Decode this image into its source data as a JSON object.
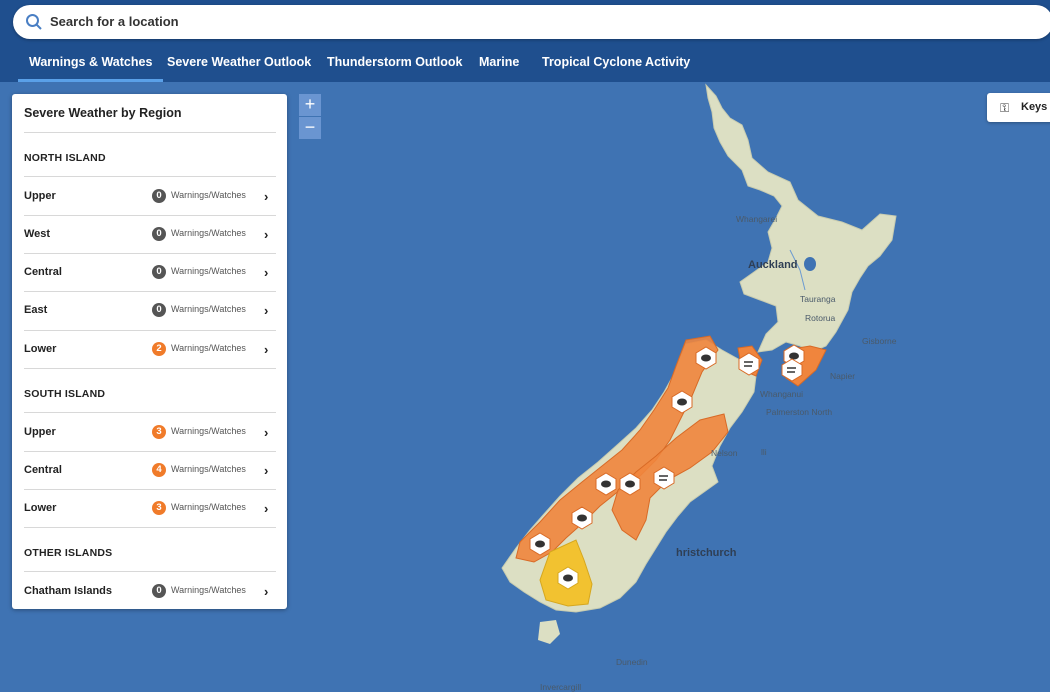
{
  "search": {
    "placeholder": "Search for a location",
    "icon": "search-icon"
  },
  "tabs": [
    {
      "label": "Warnings & Watches",
      "active": true
    },
    {
      "label": "Severe Weather Outlook"
    },
    {
      "label": "Thunderstorm Outlook"
    },
    {
      "label": "Marine"
    },
    {
      "label": "Tropical Cyclone Activity"
    }
  ],
  "panel": {
    "title": "Severe Weather by Region",
    "suffix": "Warnings/Watches",
    "sections": [
      {
        "label": "NORTH ISLAND",
        "rows": [
          {
            "name": "Upper",
            "count": "0"
          },
          {
            "name": "West",
            "count": "0"
          },
          {
            "name": "Central",
            "count": "0"
          },
          {
            "name": "East",
            "count": "0"
          },
          {
            "name": "Lower",
            "count": "2"
          }
        ]
      },
      {
        "label": "SOUTH ISLAND",
        "rows": [
          {
            "name": "Upper",
            "count": "3"
          },
          {
            "name": "Central",
            "count": "4"
          },
          {
            "name": "Lower",
            "count": "3"
          }
        ]
      },
      {
        "label": "OTHER ISLANDS",
        "rows": [
          {
            "name": "Chatham Islands",
            "count": "0"
          }
        ]
      }
    ]
  },
  "zoom": {
    "in": "+",
    "out": "−"
  },
  "keys": {
    "label": "Keys"
  },
  "cities": {
    "whangarei": "Whangarei",
    "auckland": "Auckland",
    "tauranga": "Tauranga",
    "rotorua": "Rotorua",
    "gisborne": "Gisborne",
    "napier": "Napier",
    "whanganui": "Whanganui",
    "palmerston": "Palmerston North",
    "nelson": "Nelson",
    "wellington": "lli",
    "christchurch": "hristchurch",
    "dunedin": "Dunedin",
    "invercargill": "Invercargill"
  },
  "colors": {
    "sea": "#3f73b3",
    "land": "#dcdfc3",
    "orange_warning": "#f0853d",
    "yellow_watch": "#f2c230",
    "badge_zero": "#555555",
    "badge_active": "#f07b2a",
    "header": "#1f4f8e"
  }
}
